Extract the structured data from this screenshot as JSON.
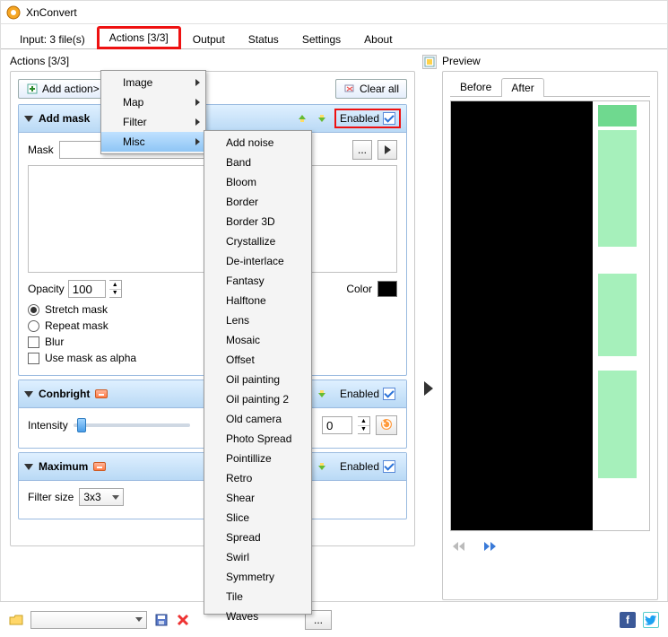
{
  "app": {
    "title": "XnConvert"
  },
  "main_tabs": {
    "input": "Input: 3 file(s)",
    "actions": "Actions [3/3]",
    "output": "Output",
    "status": "Status",
    "settings": "Settings",
    "about": "About"
  },
  "actions_panel": {
    "title": "Actions [3/3]",
    "add_action": "Add action>",
    "clear_all": "Clear all",
    "enabled_label": "Enabled"
  },
  "add_action_menu": {
    "items": [
      "Image",
      "Map",
      "Filter",
      "Misc"
    ]
  },
  "misc_submenu": [
    "Add noise",
    "Band",
    "Bloom",
    "Border",
    "Border 3D",
    "Crystallize",
    "De-interlace",
    "Fantasy",
    "Halftone",
    "Lens",
    "Mosaic",
    "Offset",
    "Oil painting",
    "Oil painting 2",
    "Old camera",
    "Photo Spread",
    "Pointillize",
    "Retro",
    "Shear",
    "Slice",
    "Spread",
    "Swirl",
    "Symmetry",
    "Tile",
    "Waves"
  ],
  "action_addmask": {
    "title": "Add mask",
    "mask_label": "Mask",
    "mask_value": "",
    "opacity_label": "Opacity",
    "opacity_value": "100",
    "color_label": "Color",
    "stretch": "Stretch mask",
    "repeat": "Repeat mask",
    "blur": "Blur",
    "use_alpha": "Use mask as alpha",
    "browse": "..."
  },
  "action_conbright": {
    "title": "Conbright",
    "intensity_label": "Intensity",
    "intensity_value": "0",
    "enabled": "Enabled"
  },
  "action_maximum": {
    "title": "Maximum",
    "filtersize_label": "Filter size",
    "filtersize_value": "3x3",
    "enabled": "Enabled"
  },
  "preview": {
    "title": "Preview",
    "tabs": {
      "before": "Before",
      "after": "After"
    }
  },
  "footer": {
    "dots": "..."
  }
}
